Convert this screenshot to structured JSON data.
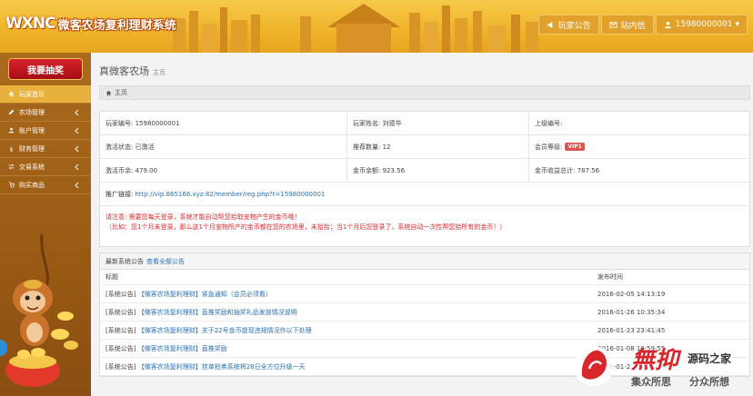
{
  "header": {
    "logo_mark": "WXNC",
    "app_title": "微客农场复利理财系统",
    "nav": [
      {
        "label": "玩家公告",
        "icon": "megaphone-icon"
      },
      {
        "label": "站内信",
        "icon": "envelope-icon"
      },
      {
        "label": "15980000001 ▾",
        "icon": "user-icon"
      }
    ]
  },
  "sidebar": {
    "lottery_label": "我要抽奖",
    "items": [
      {
        "label": "玩家首页",
        "icon": "home-icon",
        "active": true
      },
      {
        "label": "农场管理",
        "icon": "edit-icon"
      },
      {
        "label": "账户管理",
        "icon": "user-icon"
      },
      {
        "label": "财务管理",
        "icon": "dollar-icon"
      },
      {
        "label": "交易系统",
        "icon": "exchange-icon"
      },
      {
        "label": "购买商品",
        "icon": "cart-icon"
      }
    ]
  },
  "page": {
    "title": "真微客农场",
    "subtitle": "主页",
    "breadcrumb": "主页"
  },
  "info": {
    "player_id": "玩家编号: 15980000001",
    "player_name": "玩家姓名: 刘德华",
    "upline_id": "上级编号:",
    "activation_status": "激活状态: 已激活",
    "referral_count": "推荐数量: 12",
    "member_level_label": "会员等级:",
    "member_level_badge": "VIP1",
    "activation_coins": "激活币余: 479.00",
    "gold_balance": "金币余额: 923.56",
    "gold_income_total": "金币收益总计: 787.56",
    "promo_label": "推广链接:",
    "promo_url": "http://vip.865166.xyz:82/member/reg.php?t=15980000001",
    "notice_line1": "请注意: 需要您每天登录，系统才能自动帮您拾取宠物产生的金币哦！",
    "notice_line2": "（比如：您1个月未登录，那么这1个月宠物所产的金币都在您的农场里，未拾拾；当1个月后您登录了，系统自动一次性帮您拾所有的金币！）"
  },
  "announcements": {
    "heading": "最新系统公告",
    "view_all": "查看全部公告",
    "col_title": "标题",
    "col_time": "发布时间",
    "rows": [
      {
        "prefix": "[系统公告]",
        "tag": "【微客农场复利理财】",
        "text": "紧急通知（会员必须看）",
        "time": "2016-02-05 14:13:19"
      },
      {
        "prefix": "[系统公告]",
        "tag": "【微客农场复利理财】",
        "text": "直推奖励和抽奖礼品发放情况说明",
        "time": "2016-01-26 10:35:34"
      },
      {
        "prefix": "[系统公告]",
        "tag": "【微客农场复利理财】",
        "text": "关于22号金币提现违规情况作以下处理",
        "time": "2016-01-23 23:41:45"
      },
      {
        "prefix": "[系统公告]",
        "tag": "【微客农场复利理财】",
        "text": "直推奖励",
        "time": "2016-01-08 10:59:55"
      },
      {
        "prefix": "[系统公告]",
        "tag": "【微客农场复利理财】",
        "text": "挂单拍卖系统将28日全方位升级一天",
        "time": "2016-01-2"
      }
    ]
  },
  "watermark": {
    "main": "無抑",
    "side": "源码之家",
    "sub1": "集众所思",
    "sub2": "分众所想"
  },
  "colors": {
    "header": "#efb52c",
    "sidebar": "#9a5a15",
    "active": "#e8b13c",
    "link": "#2a6fb8",
    "alert": "#e0262c"
  }
}
